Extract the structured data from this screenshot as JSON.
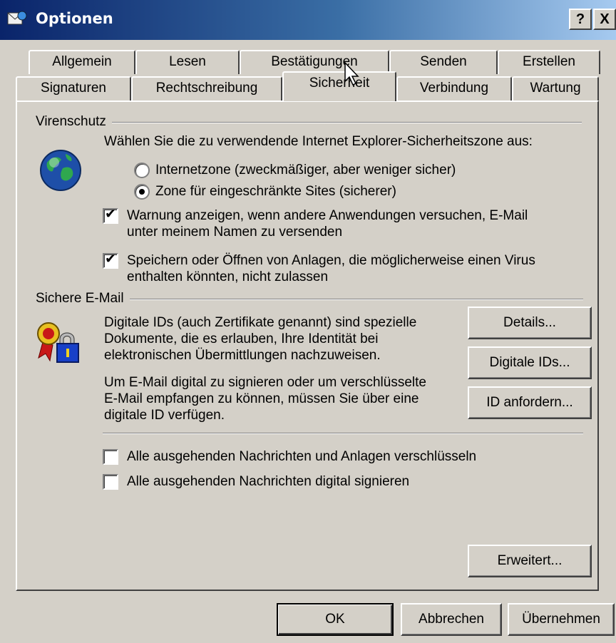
{
  "window": {
    "title": "Optionen",
    "help_btn": "?",
    "close_btn": "X"
  },
  "tabs_row1": [
    "Allgemein",
    "Lesen",
    "Bestätigungen",
    "Senden",
    "Erstellen"
  ],
  "tabs_row2": [
    "Signaturen",
    "Rechtschreibung",
    "Sicherheit",
    "Verbindung",
    "Wartung"
  ],
  "active_tab": "Sicherheit",
  "virus": {
    "group_label": "Virenschutz",
    "zone_prompt": "Wählen Sie die zu verwendende Internet Explorer-Sicherheitszone aus:",
    "zone_internet": "Internetzone (zweckmäßiger, aber weniger sicher)",
    "zone_internet_selected": false,
    "zone_restricted": "Zone für eingeschränkte Sites (sicherer)",
    "zone_restricted_selected": true,
    "warn_label_1": "Warnung anzeigen, wenn andere Anwendungen versuchen, E-Mail",
    "warn_label_2": "unter meinem Namen zu versenden",
    "warn_checked": true,
    "block_label_1": "Speichern oder Öffnen von Anlagen, die möglicherweise einen Virus",
    "block_label_2": "enthalten könnten, nicht zulassen",
    "block_checked": true,
    "icon": "globe-icon"
  },
  "secure_mail": {
    "group_label": "Sichere E-Mail",
    "desc1": [
      "Digitale IDs (auch Zertifikate genannt) sind spezielle",
      "Dokumente, die es erlauben, Ihre Identität bei",
      "elektronischen Übermittlungen nachzuweisen."
    ],
    "desc2": [
      "Um E-Mail digital zu signieren oder um verschlüsselte",
      "E-Mail empfangen zu können, müssen Sie über eine",
      "digitale ID verfügen."
    ],
    "details_btn": "Details...",
    "ids_btn": "Digitale IDs...",
    "request_btn": "ID anfordern...",
    "encrypt_label": "Alle ausgehenden Nachrichten und Anlagen verschlüsseln",
    "encrypt_checked": false,
    "sign_label": "Alle ausgehenden Nachrichten digital signieren",
    "sign_checked": false,
    "icon": "certificate-lock-icon"
  },
  "advanced_btn": "Erweitert...",
  "footer": {
    "ok": "OK",
    "cancel": "Abbrechen",
    "apply": "Übernehmen"
  },
  "check_glyph": "✔"
}
